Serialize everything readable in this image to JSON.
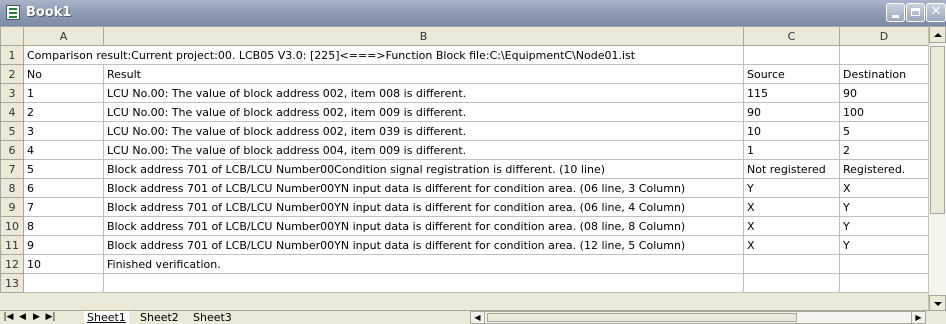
{
  "window": {
    "title": "Book1",
    "icon": "excel-workbook-icon"
  },
  "columns": [
    "A",
    "B",
    "C",
    "D"
  ],
  "rows": [
    {
      "n": "1",
      "a": "Comparison result:Current project:00. LCB05 V3.0: [225]<===>Function Block file:C:\\EquipmentC\\Node01.ist",
      "b": "",
      "c": "",
      "d": ""
    },
    {
      "n": "2",
      "a": "No",
      "b": "Result",
      "c": "Source",
      "d": "Destination"
    },
    {
      "n": "3",
      "a": "1",
      "b": "LCU No.00: The value of block address 002, item 008 is different.",
      "c": "115",
      "d": "90"
    },
    {
      "n": "4",
      "a": "2",
      "b": "LCU No.00: The value of block address 002, item 009 is different.",
      "c": "90",
      "d": "100"
    },
    {
      "n": "5",
      "a": "3",
      "b": "LCU No.00: The value of block address 002, item 039 is different.",
      "c": "10",
      "d": "5"
    },
    {
      "n": "6",
      "a": "4",
      "b": "LCU No.00: The value of block address 004, item 009 is different.",
      "c": "1",
      "d": "2"
    },
    {
      "n": "7",
      "a": "5",
      "b": "Block address 701 of LCB/LCU Number00Condition signal registration is different. (10 line)",
      "c": "Not registered",
      "d": "Registered."
    },
    {
      "n": "8",
      "a": "6",
      "b": "Block address 701 of LCB/LCU Number00YN input data is different for condition area. (06 line,  3 Column)",
      "c": "Y",
      "d": "X"
    },
    {
      "n": "9",
      "a": "7",
      "b": "Block address 701 of LCB/LCU Number00YN input data is different for condition area. (06 line,  4 Column)",
      "c": "X",
      "d": "Y"
    },
    {
      "n": "10",
      "a": "8",
      "b": "Block address 701 of LCB/LCU Number00YN input data is different for condition area. (08 line,  8 Column)",
      "c": "X",
      "d": "Y"
    },
    {
      "n": "11",
      "a": "9",
      "b": "Block address 701 of LCB/LCU Number00YN input data is different for condition area. (12 line,  5 Column)",
      "c": "X",
      "d": "Y"
    },
    {
      "n": "12",
      "a": "10",
      "b": "Finished verification.",
      "c": "",
      "d": ""
    },
    {
      "n": "13",
      "a": "",
      "b": "",
      "c": "",
      "d": ""
    }
  ],
  "sheets": [
    "Sheet1",
    "Sheet2",
    "Sheet3"
  ],
  "active_sheet": "Sheet1"
}
